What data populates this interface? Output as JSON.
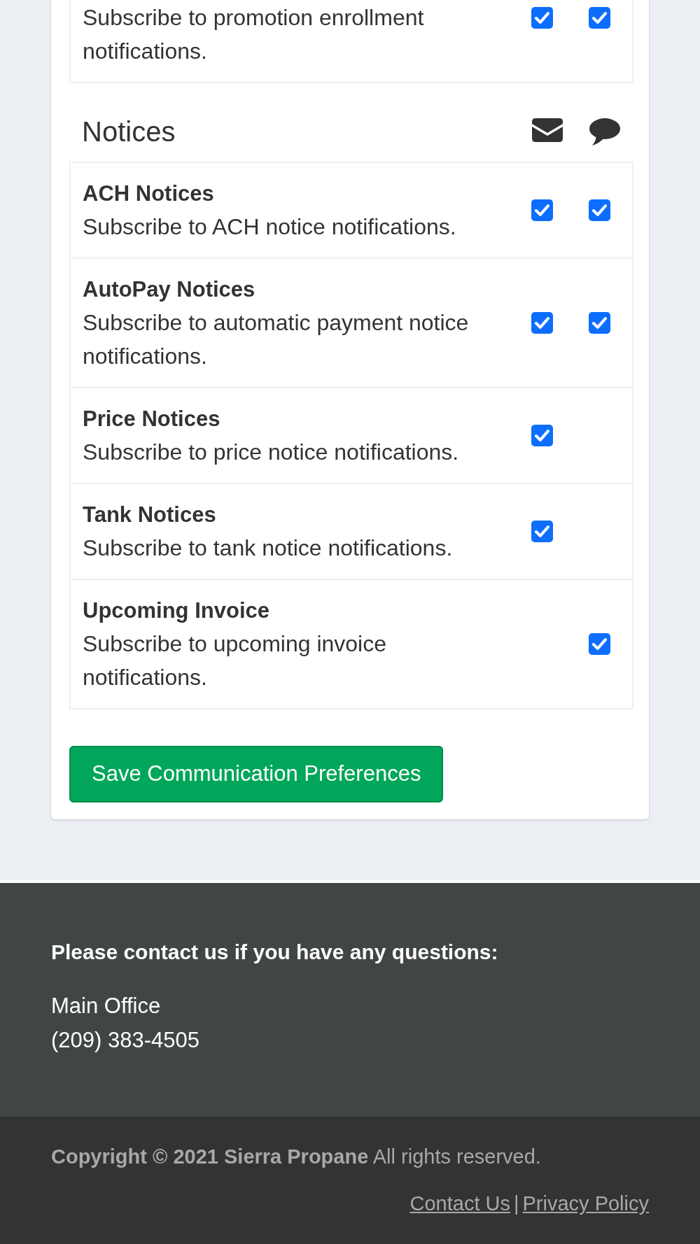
{
  "sections": [
    {
      "rows": [
        {
          "description": "Subscribe to promotion enrollment notifications.",
          "email": {
            "checked": true
          },
          "sms": {
            "checked": true
          }
        }
      ]
    },
    {
      "title": "Notices",
      "rows": [
        {
          "title": "ACH Notices",
          "description": "Subscribe to ACH notice notifications.",
          "email": {
            "checked": true
          },
          "sms": {
            "checked": true
          }
        },
        {
          "title": "AutoPay Notices",
          "description": "Subscribe to automatic payment notice notifications.",
          "email": {
            "checked": true
          },
          "sms": {
            "checked": true
          }
        },
        {
          "title": "Price Notices",
          "description": "Subscribe to price notice notifications.",
          "email": {
            "checked": true
          }
        },
        {
          "title": "Tank Notices",
          "description": "Subscribe to tank notice notifications.",
          "email": {
            "checked": true
          }
        },
        {
          "title": "Upcoming Invoice",
          "description": "Subscribe to upcoming invoice notifications.",
          "sms": {
            "checked": true
          }
        }
      ]
    }
  ],
  "save_button": {
    "label": "Save Communication Preferences"
  },
  "footer": {
    "heading": "Please contact us if you have any questions:",
    "office": {
      "name": "Main Office",
      "phone": "(209) 383-4505"
    }
  },
  "bottom_bar": {
    "copyright": "**Copyright © 2021 Sierra Propane** All rights reserved.",
    "links": [
      {
        "label": "Contact Us"
      },
      {
        "label": "Privacy Policy"
      }
    ],
    "separator": "|"
  }
}
